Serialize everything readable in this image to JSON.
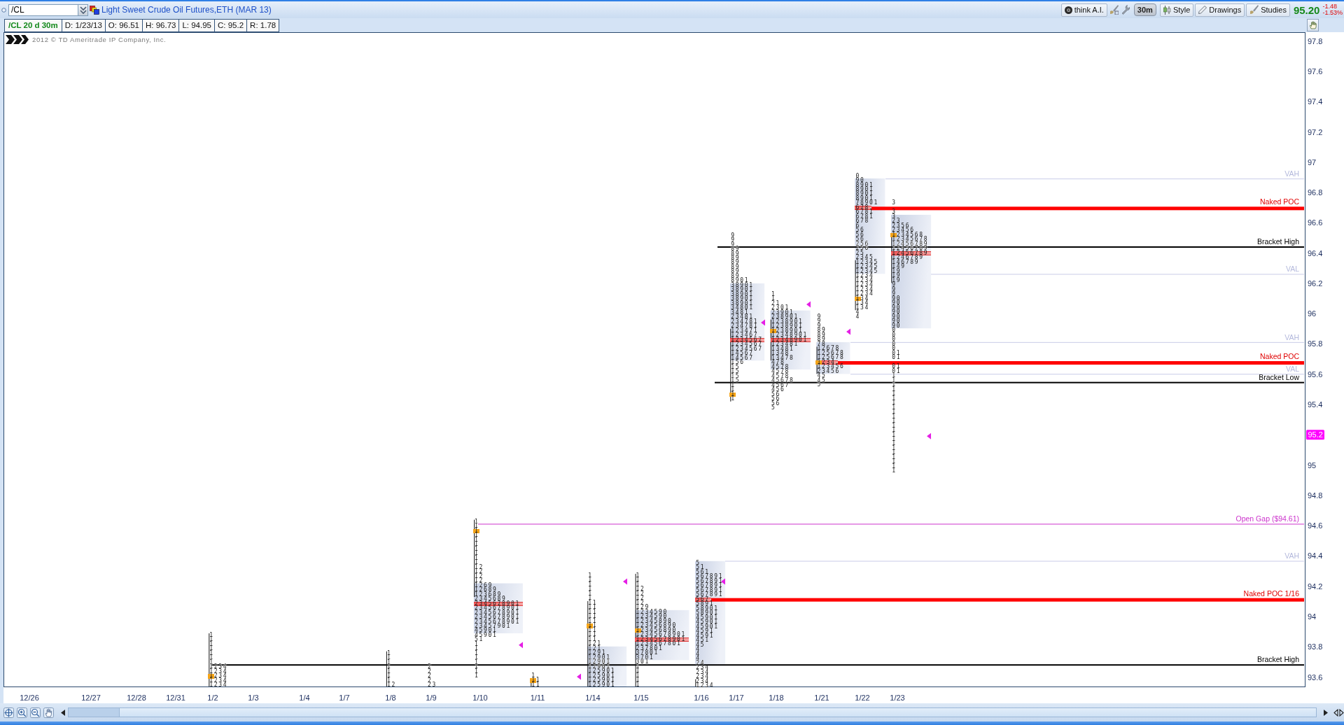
{
  "toolbar": {
    "symbol": "/CL",
    "title": "Light Sweet Crude Oil Futures,ETH (MAR 13)",
    "buttons": [
      {
        "kind": "menu",
        "label": "think A.I."
      },
      {
        "kind": "icon"
      },
      {
        "kind": "icon"
      },
      {
        "kind": "period",
        "label": "30m"
      },
      {
        "kind": "menu",
        "label": "Style"
      },
      {
        "kind": "menu",
        "label": "Drawings"
      },
      {
        "kind": "menu",
        "label": "Studies"
      }
    ],
    "quote": {
      "last": "95.20",
      "last_uptick": true,
      "change": "-1.48",
      "change_percent": "-1.53%",
      "change_negative": true
    }
  },
  "info_bar": {
    "study": "/CL 20 d 30m",
    "fields": [
      "D: 1/23/13",
      "O: 96.51",
      "H: 96.73",
      "L: 94.95",
      "C: 95.2",
      "R: 1.78"
    ]
  },
  "copyright": "2012 © TD Ameritrade IP Company, Inc.",
  "chart": {
    "yticks": [
      "97.8",
      "97.6",
      "97.4",
      "97.2",
      "97",
      "96.8",
      "96.6",
      "96.4",
      "96.2",
      "96",
      "95.8",
      "95.6",
      "95.4",
      "95",
      "94.8",
      "94.6",
      "94.4",
      "94.2",
      "94",
      "93.8",
      "93.6"
    ],
    "last_price": "95.2",
    "levels": [
      {
        "kind": "value_area",
        "label": "VAH"
      },
      {
        "kind": "naked_poc",
        "label": "Naked POC"
      },
      {
        "kind": "bracket",
        "label": "Bracket High"
      },
      {
        "kind": "value_area",
        "label": "VAL"
      },
      {
        "kind": "value_area",
        "label": "VAH"
      },
      {
        "kind": "naked_poc",
        "label": "Naked POC"
      },
      {
        "kind": "value_area",
        "label": "VAL"
      },
      {
        "kind": "bracket",
        "label": "Bracket Low"
      },
      {
        "kind": "gap",
        "label": "Open Gap ($94.61)"
      },
      {
        "kind": "value_area",
        "label": "VAH"
      },
      {
        "kind": "naked_poc",
        "label": "Naked POC 1/16"
      },
      {
        "kind": "bracket",
        "label": "Bracket High"
      }
    ],
    "days": [
      {
        "label": "12/26"
      },
      {
        "label": "12/27"
      },
      {
        "label": "12/28"
      },
      {
        "label": "12/31"
      },
      {
        "label": "1/2",
        "profile": {
          "segments": [
            {
              "rows": [
                "1",
                "1",
                "1",
                "1",
                "1",
                "1",
                "1",
                "1 2 3 4",
                "1 2 3 4",
                "1 2 3 4",
                "1 2 3 4",
                "1 2 3 4"
              ]
            }
          ],
          "value_area": false,
          "poc": false,
          "open": true,
          "ib_line": true,
          "close_marker": false
        }
      },
      {
        "label": "1/3"
      },
      {
        "label": "1/4"
      },
      {
        "label": "1/7"
      },
      {
        "label": "1/8",
        "profile": {
          "segments": [
            {
              "rows": [
                "1",
                "1",
                "1",
                "1",
                "1",
                "1",
                "1",
                "1 2"
              ]
            }
          ],
          "value_area": false,
          "poc": false,
          "open": false,
          "ib_line": true,
          "close_marker": false
        }
      },
      {
        "label": "1/9",
        "profile": {
          "segments": [
            {
              "rows": [
                "2",
                "2",
                "2",
                "2",
                "2 3"
              ]
            }
          ],
          "value_area": false,
          "poc": false,
          "open": false,
          "ib_line": false,
          "close_marker": false
        }
      },
      {
        "label": "1/10",
        "profile": {
          "segments": [
            {
              "rows": [
                "1",
                "1",
                "1",
                "1",
                "1",
                "1",
                "1",
                "1",
                "1",
                "1",
                "1 2",
                "1 2",
                "1 2",
                "1 2",
                "1 2 6 9",
                "1 2 6 8 9",
                "1 2 3 6 8 9",
                "2 3 4 5 6 8 9",
                "2 3 4 5 6 7 8 9 0 1",
                "2 3 4 5 6 7 8 9 0 1",
                "2 3 4 5 6 7 8 9 0 1",
                "2 3 4 5 6 7 8 9 0 1",
                "2 3 4 5 6 7 8 9 0 1",
                "2 3 4 5 7 9 0 1",
                "4 5 9 0 1",
                "4 5 9 0 1",
                "5 1",
                "1",
                "1",
                "1",
                "1",
                "1",
                "1",
                "1",
                "1"
              ]
            }
          ],
          "value_area": true,
          "poc": true,
          "open": true,
          "ib_line": true,
          "close_marker": true
        }
      },
      {
        "label": "1/11",
        "profile": {
          "segments": [
            {
              "rows": [
                "1",
                "1 1",
                "1 1"
              ]
            }
          ],
          "value_area": false,
          "poc": false,
          "open": true,
          "ib_line": true,
          "close_marker": true
        }
      },
      {
        "label": "1/14",
        "profile": {
          "segments": [
            {
              "rows": [
                "1",
                "1",
                "1",
                "1",
                "1",
                "1",
                "1 1",
                "1 1",
                "1 1",
                "1 1",
                "1 1",
                "1 1",
                "1 1",
                "1 1",
                "1 1",
                "1 2 1",
                "1 2 1",
                "1 2 9 1",
                "1 2 9 0 1",
                "1 2 9 0 1",
                "1 2 9 0 1",
                "1 2 5 9 0 1",
                "1 2 5 9 0 1",
                "1 2 5 9 0 1",
                "1 2 5 9 0 1"
              ]
            }
          ],
          "value_area": true,
          "poc": false,
          "open": true,
          "ib_line": true,
          "close_marker": true
        }
      },
      {
        "label": "1/15",
        "profile": {
          "segments": [
            {
              "rows": [
                "1",
                "1",
                "1",
                "1 2",
                "1 2",
                "1 2",
                "1 2",
                "1 2 9",
                "1 2 3 4 5 9 0",
                "1 2 3 4 5 9 0",
                "1 2 3 4 5 8 9 0",
                "1 2 3 4 5 6 8 9 0",
                "1 2 3 4 5 6 8 9 0",
                "1 2 3 4 5 6 7 8 9 0 1",
                "1 2 3 4 5 6 7 8 9 0 1",
                "1 2 3 4 5 6 7 8 0 1",
                "2 3 7 8 0 1",
                "3 7 8 0 1",
                "3 7 0 1",
                "3 0 1",
                "1",
                "1",
                "1",
                "1",
                "1"
              ]
            }
          ],
          "value_area": true,
          "poc": true,
          "open": true,
          "ib_line": true,
          "close_marker": false
        }
      },
      {
        "label": "1/16",
        "profile": {
          "segments": [
            {
              "rows": [
                "5",
                "5 1",
                "5 6 1",
                "5 6 7 8 9 1",
                "5 6 7 8 9 1",
                "5 6 7 8 9 1",
                "5 6 7 8 9 1",
                "5 6 7 8 9 1",
                "5 6 7",
                "5 8 9 1",
                "5 8 9 0 1",
                "5 8 9 0 1",
                "4 5 9 0 1",
                "4 5 9 0 1",
                "4 5 9 0 1",
                "4 5 9 1",
                "4 5 9 1",
                "4 5 1",
                "4 5",
                "4",
                "4",
                "4",
                "2 4",
                "2 3 4",
                "2 3 4",
                "2 3 4",
                "2 3 4",
                "1 2 3 4"
              ]
            }
          ],
          "value_area": true,
          "poc": true,
          "open": false,
          "ib_line": true,
          "close_marker": true
        }
      },
      {
        "label": "1/17",
        "profile": {
          "segments": [
            {
              "rows": [
                "9",
                "9",
                "9",
                "8 9",
                "8 9",
                "8 9",
                "8 9",
                "8 9",
                "8 9",
                "8 9",
                "8 9 0 1",
                "3 8 9 0 1",
                "3 8 9 0 1",
                "3 8 9 0 1",
                "3 8 9 0 1",
                "3 8 9 0 1",
                "3 4 8 0 1",
                "3 4 8 1",
                "2 3 4 8 1",
                "2 3 4 7 8 1",
                "2 3 4 7 8 1",
                "1 2 3 4 7 1",
                "1 2 3 4 6 7",
                "1 2 3 4 5 6 7",
                "1 2 3 4 5 6 7",
                "1 2 3 4 5 6 7",
                "1 4 5 6 7",
                "1 4 5 6 7",
                "1 5 6",
                "1 5",
                "1 5",
                "1 5",
                "1 5",
                "1",
                "1",
                "1",
                "1"
              ]
            }
          ],
          "value_area": true,
          "poc": true,
          "open": true,
          "ib_line": true,
          "close_marker": true
        }
      },
      {
        "label": "1/18",
        "profile": {
          "segments": [
            {
              "rows": [
                "1",
                "1",
                "2 1",
                "2 3 0 1",
                "2 3 9 0 1",
                "2 3 8 9 0 1",
                "1 2 3 8 9 0 1",
                "1 2 3 8 9 0 1",
                "1 2 3 8 9 0 1",
                "1 2 3 4 8 9 0 1",
                "1 2 3 4 8 9 0 1",
                "1 2 3 4 8 1",
                "1 3 4 8 1",
                "1 3 4 8",
                "1 3 4 7 8",
                "4 7 8",
                "4 5 7 8",
                "4 5 7 8",
                "4 5 7 8",
                "4 5 6 7 8",
                "4 5 6 7",
                "4 5 6",
                "5 6",
                "5 6",
                "5 6",
                "5"
              ]
            }
          ],
          "value_area": true,
          "poc": true,
          "open": true,
          "ib_line": true,
          "close_marker": true
        }
      },
      {
        "label": "1/21",
        "profile": {
          "segments": [
            {
              "rows": [
                "9",
                "9",
                "9",
                "8 9",
                "8 9",
                "8 9",
                "7 8",
                "1 2 6 7 8",
                "1 2 5 6 7 8",
                "1 2 5 6 7 8",
                "1 2 3 4",
                "1 2 3 4 5 6",
                "2 3 4 5 6",
                "4 5",
                "4 5",
                "5"
              ]
            }
          ],
          "value_area": true,
          "poc": true,
          "open": true,
          "ib_line": true,
          "close_marker": true
        }
      },
      {
        "label": "1/22",
        "profile": {
          "segments": [
            {
              "rows": [
                "0",
                "9 0",
                "8 9 0 1",
                "8 9 0 1",
                "8 9 0 1",
                "8 9 0 1",
                "7 8 9 0 1",
                "6 7 8",
                "6 7 8 1",
                "6 7 8 1",
                "6 7 8",
                "6",
                "5 6",
                "5 6",
                "5 6",
                "2 5 6",
                "2 5 6",
                "2 5",
                "2 3 4 5",
                "1 2 3 4 5",
                "1 2 3 4 5",
                "1 2 3 4 5",
                "1 2 3 4",
                "1 2 3 4",
                "1 2 3 4",
                "1 2 3 4",
                "1 2 3 4",
                "1 3 4",
                "1 3 4",
                "1 3 4",
                "4",
                "4"
              ]
            }
          ],
          "value_area": true,
          "poc": true,
          "open": true,
          "ib_line": true,
          "close_marker": false
        }
      },
      {
        "label": "1/23",
        "profile": {
          "segments": [
            {
              "rows": [
                "3"
              ]
            },
            {
              "rows": [
                "3",
                "3",
                "2 3",
                "2 3 5 6",
                "2 3 4 5 6",
                "1 2 3 4 5 6 8",
                "1 2 3 4 5 6 7 8",
                "1 2 4 5 6 7 8 9",
                "1 2 4 5 6 7 8 9",
                "1 2 4 5 6 7 8 9",
                "1 2 4 6 7 8 9",
                "1 4 6 7 8 9",
                "1 4 9",
                "1 9",
                "1 9",
                "1 9",
                "9",
                "9",
                "9",
                "9 0",
                "9 0",
                "9 0",
                "9 0",
                "9 0",
                "9 0",
                "9 0",
                "0",
                "0",
                "0",
                "0",
                "0",
                "0 1",
                "0 1"
              ]
            },
            {
              "rows": [
                "0 1",
                "0 1",
                "1",
                "1",
                "1",
                "1",
                "1",
                "1",
                "1",
                "1",
                "1",
                "1",
                "1",
                "1",
                "1",
                "1",
                "1",
                "1",
                "1",
                "1",
                "1",
                "1",
                "1",
                "1"
              ]
            }
          ],
          "value_area": true,
          "poc": true,
          "open": true,
          "ib_line": true,
          "close_marker": true
        }
      }
    ]
  }
}
